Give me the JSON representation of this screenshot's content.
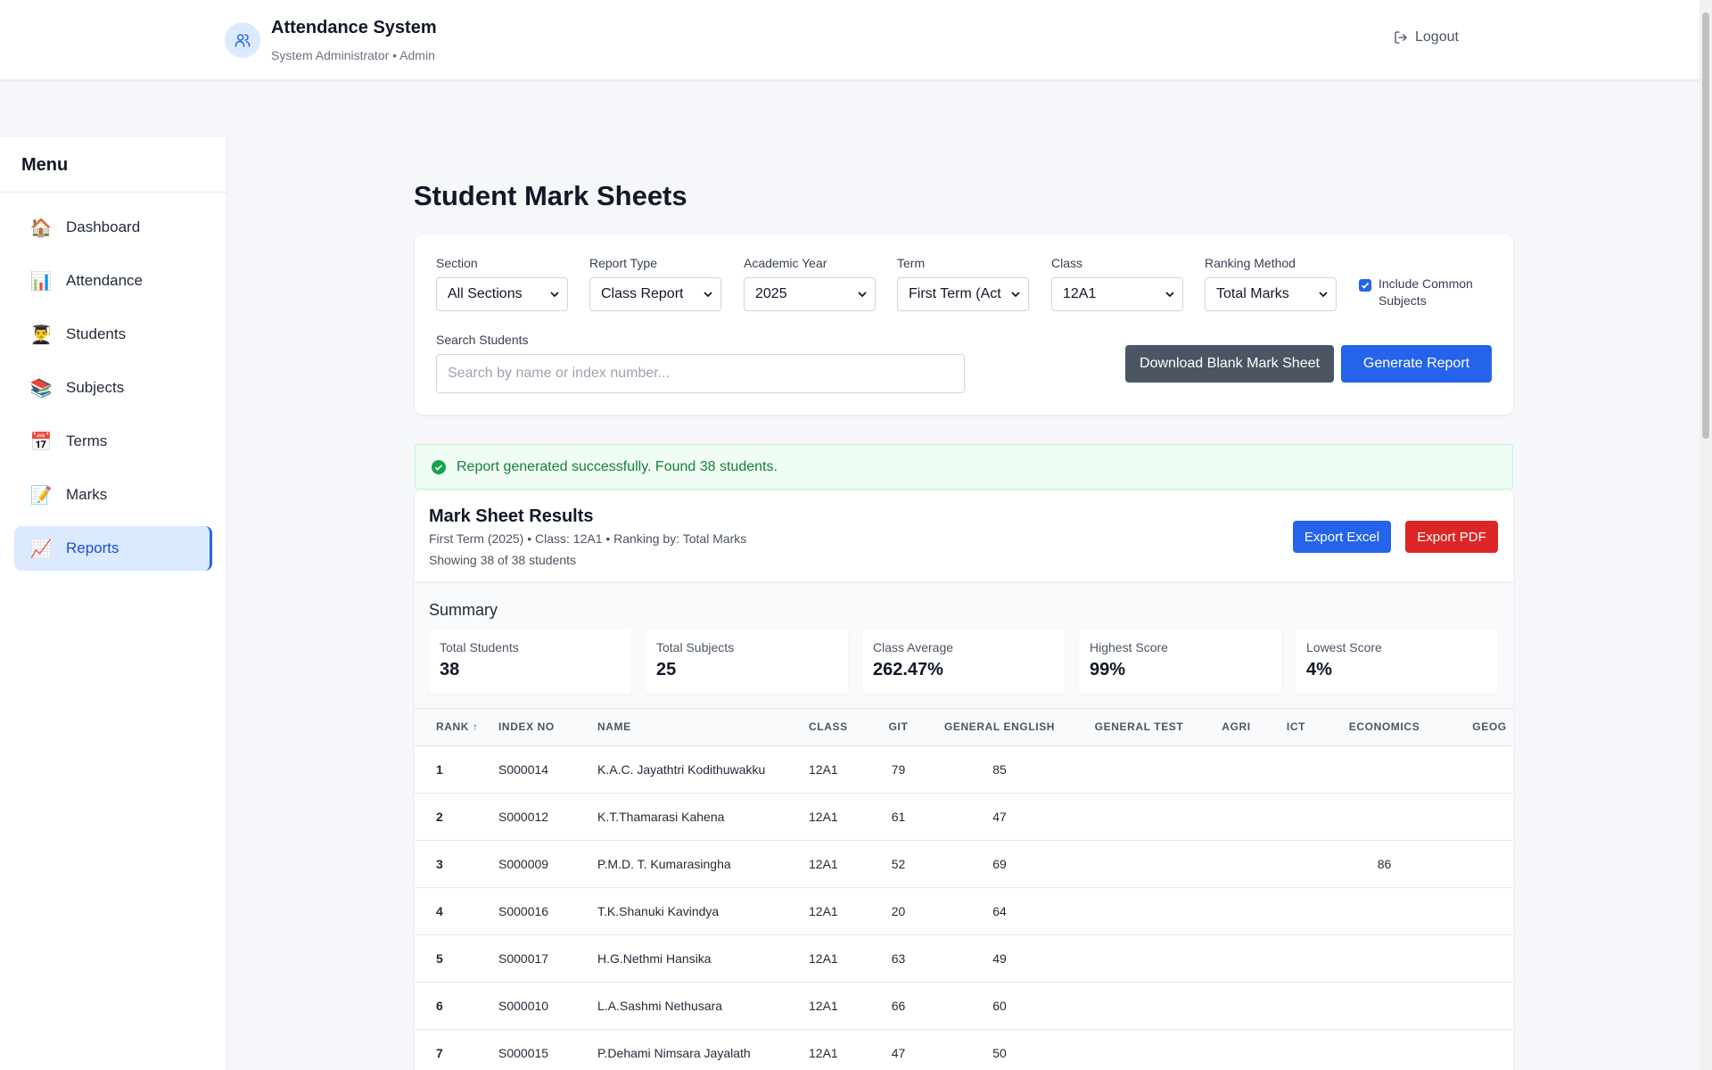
{
  "header": {
    "app_title": "Attendance System",
    "user_line": "System Administrator • Admin",
    "logout_label": "Logout"
  },
  "sidebar": {
    "title": "Menu",
    "items": [
      {
        "emoji": "🏠",
        "label": "Dashboard"
      },
      {
        "emoji": "📊",
        "label": "Attendance"
      },
      {
        "emoji": "👨‍🎓",
        "label": "Students"
      },
      {
        "emoji": "📚",
        "label": "Subjects"
      },
      {
        "emoji": "📅",
        "label": "Terms"
      },
      {
        "emoji": "📝",
        "label": "Marks"
      },
      {
        "emoji": "📈",
        "label": "Reports"
      }
    ],
    "active_item": "Reports"
  },
  "page": {
    "title": "Student Mark Sheets"
  },
  "filters": {
    "section": {
      "label": "Section",
      "value": "All Sections"
    },
    "report_type": {
      "label": "Report Type",
      "value": "Class Report"
    },
    "academic_year": {
      "label": "Academic Year",
      "value": "2025"
    },
    "term": {
      "label": "Term",
      "value": "First Term (Act"
    },
    "class": {
      "label": "Class",
      "value": "12A1"
    },
    "ranking_method": {
      "label": "Ranking Method",
      "value": "Total Marks"
    },
    "include_common": {
      "label": "Include Common Subjects",
      "checked": true
    },
    "search": {
      "label": "Search Students",
      "placeholder": "Search by name or index number...",
      "value": ""
    },
    "download_blank_label": "Download Blank Mark Sheet",
    "generate_label": "Generate Report"
  },
  "alert": {
    "message": "Report generated successfully. Found 38 students."
  },
  "results": {
    "title": "Mark Sheet Results",
    "subtitle": "First Term (2025) • Class: 12A1 • Ranking by: Total Marks",
    "showing": "Showing 38 of 38 students",
    "export_excel_label": "Export Excel",
    "export_pdf_label": "Export PDF"
  },
  "summary": {
    "title": "Summary",
    "cards": [
      {
        "label": "Total Students",
        "value": "38"
      },
      {
        "label": "Total Subjects",
        "value": "25"
      },
      {
        "label": "Class Average",
        "value": "262.47%"
      },
      {
        "label": "Highest Score",
        "value": "99%"
      },
      {
        "label": "Lowest Score",
        "value": "4%"
      }
    ]
  },
  "table": {
    "columns": [
      "Rank ↑",
      "Index No",
      "Name",
      "Class",
      "GIT",
      "General English",
      "General Test",
      "AGRI",
      "ICT",
      "Economics",
      "GEOG"
    ],
    "rows": [
      [
        "1",
        "S000014",
        "K.A.C. Jayathtri Kodithuwakku",
        "12A1",
        "79",
        "85",
        "",
        "",
        "",
        "",
        ""
      ],
      [
        "2",
        "S000012",
        "K.T.Thamarasi Kahena",
        "12A1",
        "61",
        "47",
        "",
        "",
        "",
        "",
        ""
      ],
      [
        "3",
        "S000009",
        "P.M.D. T. Kumarasingha",
        "12A1",
        "52",
        "69",
        "",
        "",
        "",
        "86",
        ""
      ],
      [
        "4",
        "S000016",
        "T.K.Shanuki Kavindya",
        "12A1",
        "20",
        "64",
        "",
        "",
        "",
        "",
        ""
      ],
      [
        "5",
        "S000017",
        "H.G.Nethmi Hansika",
        "12A1",
        "63",
        "49",
        "",
        "",
        "",
        "",
        ""
      ],
      [
        "6",
        "S000010",
        "L.A.Sashmi Nethusara",
        "12A1",
        "66",
        "60",
        "",
        "",
        "",
        "",
        ""
      ],
      [
        "7",
        "S000015",
        "P.Dehami Nimsara Jayalath",
        "12A1",
        "47",
        "50",
        "",
        "",
        "",
        "",
        ""
      ]
    ]
  },
  "colors": {
    "primary": "#2563eb",
    "danger": "#dc2626",
    "dark_button": "#4b5563",
    "success_text": "#15803d",
    "success_bg": "#f0fdf4",
    "active_nav_bg": "#dbeafe"
  }
}
